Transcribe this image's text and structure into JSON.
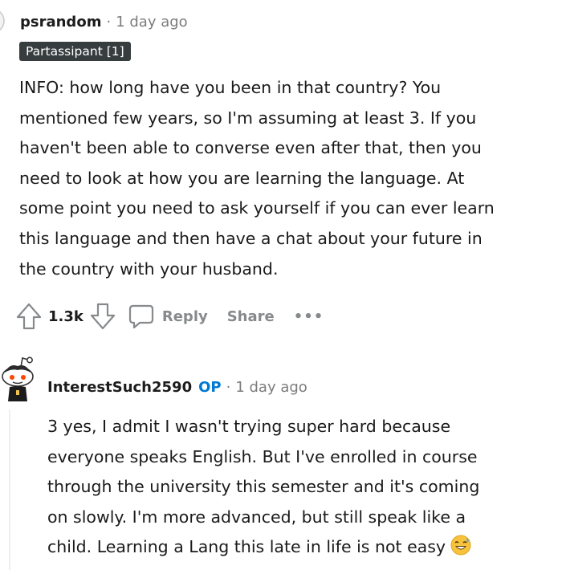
{
  "comments": [
    {
      "username": "psrandom",
      "separator": "·",
      "timestamp": "1 day ago",
      "flair": "Partassipant [1]",
      "body_lines": [
        "INFO: how long have you been in that country? You",
        "mentioned few years, so I'm assuming at least 3. If you",
        "haven't been able to converse even after that, then you",
        "need to look at how you are learning the language. At",
        "some point you need to ask yourself if you can ever learn",
        "this language and then have a chat about your future in",
        "the country with your husband."
      ],
      "actions": {
        "upvote_icon": "upvote-arrow-icon",
        "vote_count": "1.3k",
        "downvote_icon": "downvote-arrow-icon",
        "reply_icon": "speech-bubble-icon",
        "reply_label": "Reply",
        "share_label": "Share",
        "more_label": "•••"
      }
    },
    {
      "username": "InterestSuch2590",
      "op_badge": "OP",
      "separator": "·",
      "timestamp": "1 day ago",
      "body_lines": [
        "3 yes, I admit I wasn't trying super hard because",
        "everyone speaks English. But I've enrolled in course",
        "through the university this semester and it's coming",
        "on slowly. I'm more advanced, but still speak like a",
        "child. Learning a Lang this late in life is not easy"
      ],
      "trailing_emoji": "sweat-smile-emoji"
    }
  ],
  "colors": {
    "text": "#1a1a1b",
    "meta": "#7c7c7c",
    "action": "#878a8c",
    "flair_bg": "#373c3f",
    "op": "#0079d3",
    "emoji": "#f7c33c"
  }
}
